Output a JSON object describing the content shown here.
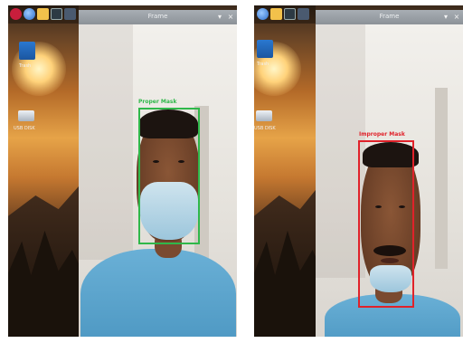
{
  "colors": {
    "mask_box": "#2fb84a",
    "improper_box": "#e0222a"
  },
  "icons": [
    "raspberry-menu-icon",
    "browser-icon",
    "folder-icon",
    "terminal-icon",
    "app-icon",
    "trash-icon",
    "drive-icon"
  ],
  "left": {
    "desktop": {
      "trash_label": "Trash",
      "drive_label": "USB DISK"
    },
    "window": {
      "title": "Frame",
      "min": "▾",
      "close": "×"
    },
    "detection": {
      "label": "Proper Mask"
    }
  },
  "right": {
    "desktop": {
      "trash_label": "Trash",
      "drive_label": "USB DISK"
    },
    "window": {
      "title": "Frame",
      "min": "▾",
      "close": "×"
    },
    "detection": {
      "label": "Improper Mask"
    }
  }
}
